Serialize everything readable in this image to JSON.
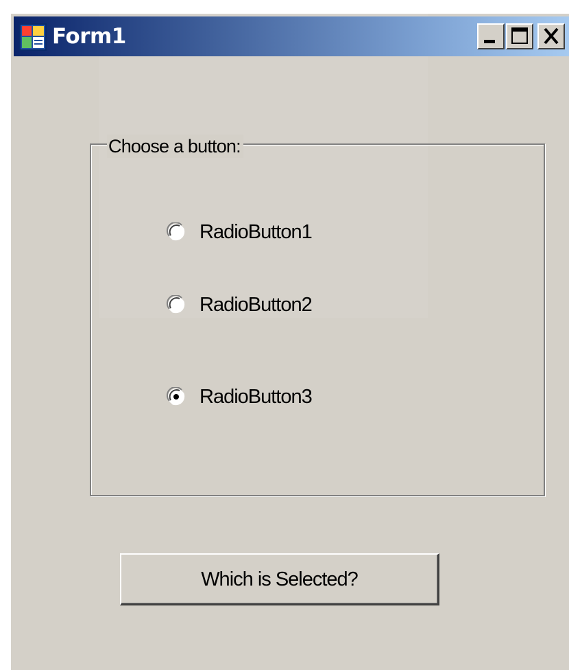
{
  "window": {
    "title": "Form1",
    "controls": {
      "minimize_icon": "minimize-icon",
      "maximize_icon": "maximize-icon",
      "close_icon": "close-icon"
    }
  },
  "groupbox": {
    "label": "Choose a button:",
    "options": [
      {
        "label": "RadioButton1",
        "checked": false
      },
      {
        "label": "RadioButton2",
        "checked": false
      },
      {
        "label": "RadioButton3",
        "checked": true
      }
    ]
  },
  "actions": {
    "which_selected_label": "Which is Selected?"
  },
  "colors": {
    "form_background": "#d4d0c8",
    "titlebar_start": "#0a246a",
    "titlebar_end": "#a6caf0",
    "title_text": "#ffffff"
  }
}
